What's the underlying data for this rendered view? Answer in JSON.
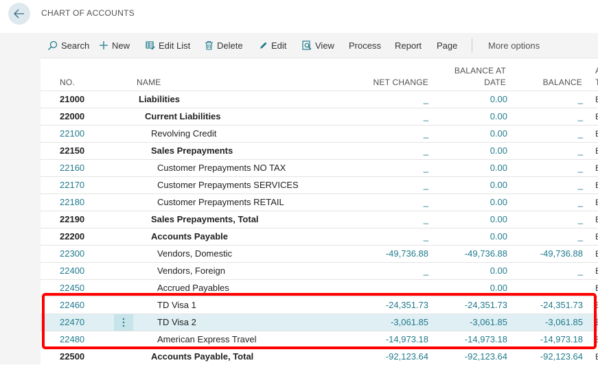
{
  "header": {
    "title": "CHART OF ACCOUNTS",
    "back_icon": "arrow-left-icon"
  },
  "actions": [
    {
      "label": "Search",
      "icon": "search-icon"
    },
    {
      "label": "New",
      "icon": "plus-icon"
    },
    {
      "label": "Edit List",
      "icon": "edit-list-icon"
    },
    {
      "label": "Delete",
      "icon": "trash-icon"
    },
    {
      "label": "Edit",
      "icon": "pencil-icon"
    },
    {
      "label": "View",
      "icon": "view-icon"
    },
    {
      "label": "Process"
    },
    {
      "label": "Report"
    },
    {
      "label": "Page"
    },
    {
      "label": "More options"
    }
  ],
  "columns": {
    "no": "NO.",
    "name": "NAME",
    "net_change": "NET CHANGE",
    "balance_at_date_1": "BALANCE AT",
    "balance_at_date_2": "DATE",
    "balance": "BALANCE",
    "next_1": "A",
    "next_2": "T"
  },
  "rows": [
    {
      "no": "21000",
      "name": "Liabilities",
      "net": "_",
      "bad": "0.00",
      "bal": "_",
      "next": "E"
    },
    {
      "no": "22000",
      "name": "Current Liabilities",
      "net": "_",
      "bad": "0.00",
      "bal": "_",
      "next": "E"
    },
    {
      "no": "22100",
      "name": "Revolving Credit",
      "net": "_",
      "bad": "0.00",
      "bal": "_",
      "next": "E"
    },
    {
      "no": "22150",
      "name": "Sales Prepayments",
      "net": "_",
      "bad": "0.00",
      "bal": "_",
      "next": "E"
    },
    {
      "no": "22160",
      "name": "Customer Prepayments NO TAX",
      "net": "_",
      "bad": "0.00",
      "bal": "_",
      "next": "E"
    },
    {
      "no": "22170",
      "name": "Customer Prepayments SERVICES",
      "net": "_",
      "bad": "0.00",
      "bal": "_",
      "next": "E"
    },
    {
      "no": "22180",
      "name": "Customer Prepayments RETAIL",
      "net": "_",
      "bad": "0.00",
      "bal": "_",
      "next": "E"
    },
    {
      "no": "22190",
      "name": "Sales Prepayments, Total",
      "net": "_",
      "bad": "0.00",
      "bal": "_",
      "next": "E"
    },
    {
      "no": "22200",
      "name": "Accounts Payable",
      "net": "_",
      "bad": "0.00",
      "bal": "_",
      "next": "E"
    },
    {
      "no": "22300",
      "name": "Vendors, Domestic",
      "net": "-49,736.88",
      "bad": "-49,736.88",
      "bal": "-49,736.88",
      "next": "E"
    },
    {
      "no": "22400",
      "name": "Vendors, Foreign",
      "net": "_",
      "bad": "0.00",
      "bal": "_",
      "next": "E"
    },
    {
      "no": "22450",
      "name": "Accrued Payables",
      "net": "",
      "bad": "0.00",
      "bal": "",
      "next": "E"
    },
    {
      "no": "22460",
      "name": "TD Visa 1",
      "net": "-24,351.73",
      "bad": "-24,351.73",
      "bal": "-24,351.73",
      "next": "E"
    },
    {
      "no": "22470",
      "name": "TD Visa 2",
      "net": "-3,061.85",
      "bad": "-3,061.85",
      "bal": "-3,061.85",
      "next": "E"
    },
    {
      "no": "22480",
      "name": "American Express Travel",
      "net": "-14,973.18",
      "bad": "-14,973.18",
      "bal": "-14,973.18",
      "next": "E"
    },
    {
      "no": "22500",
      "name": "Accounts Payable, Total",
      "net": "-92,123.64",
      "bad": "-92,123.64",
      "bal": "-92,123.64",
      "next": "E"
    }
  ],
  "colors": {
    "link": "#1f7a8c",
    "highlight": "#ff0000",
    "selected_row": "#dfeff3"
  }
}
